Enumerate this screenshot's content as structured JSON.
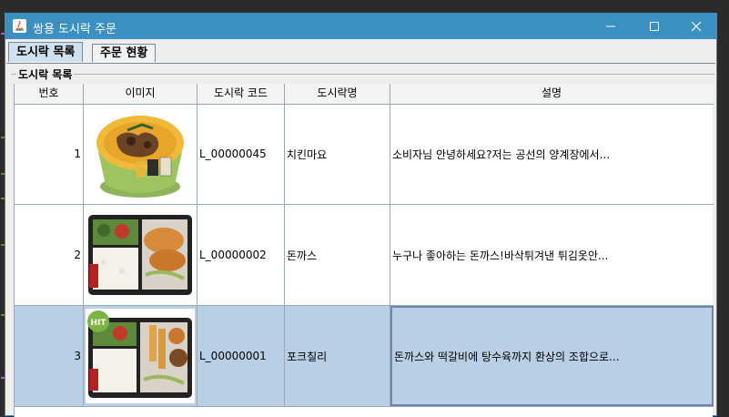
{
  "window": {
    "title": "쌍용 도시락 주문"
  },
  "tabs": [
    {
      "label": "도시락 목록",
      "active": true
    },
    {
      "label": "주문 현황",
      "active": false
    }
  ],
  "group": {
    "title": "도시락 목록"
  },
  "table": {
    "columns": [
      "번호",
      "이미지",
      "도시락 코드",
      "도시락명",
      "설명"
    ],
    "rows": [
      {
        "num": "1",
        "image": "chicken-mayo-bowl",
        "code": "L_00000045",
        "name": "치킨마요",
        "desc": "소비자님 안녕하세요?저는 공선의 양계장에서...",
        "selected": false
      },
      {
        "num": "2",
        "image": "donkatsu-box",
        "code": "L_00000002",
        "name": "돈까스",
        "desc": "누구나 좋아하는 돈까스!바삭튀겨낸 튀김옷안...",
        "selected": false
      },
      {
        "num": "3",
        "image": "pork-chili-box",
        "code": "L_00000001",
        "name": "포크칠리",
        "desc": "돈까스와 떡갈비에 탕수육까지 환상의 조합으로...",
        "selected": true
      }
    ]
  },
  "badge": {
    "hit": "HIT"
  },
  "colors": {
    "titlebar": "#3c8fc1",
    "selection": "#b8cfe5"
  }
}
